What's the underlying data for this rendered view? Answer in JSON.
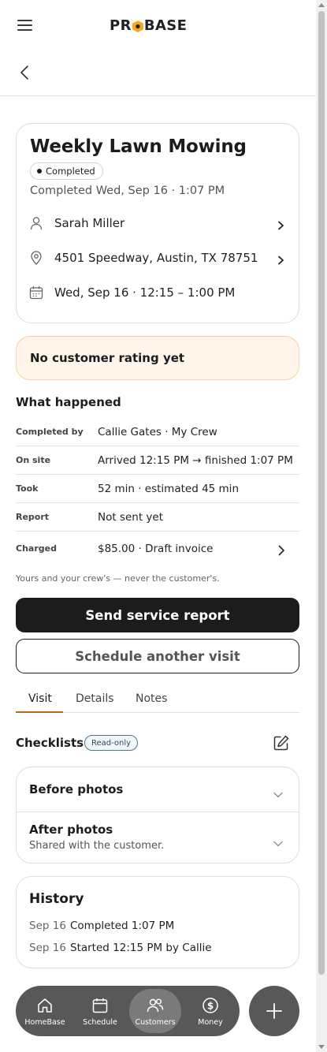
{
  "header": {
    "logo_left": "PR",
    "logo_right": "BASE",
    "accent_color": "#f5a623"
  },
  "job": {
    "title": "Weekly Lawn Mowing",
    "status": "Completed",
    "completed_line": "Completed Wed, Sep 16 · 1:07 PM",
    "customer": "Sarah Miller",
    "address": "4501 Speedway, Austin, TX 78751",
    "schedule": "Wed, Sep 16 · 12:15 – 1:00 PM"
  },
  "rating": {
    "text": "No customer rating yet",
    "bg_color": "#fff5eb"
  },
  "what_happened": {
    "heading": "What happened",
    "rows": [
      {
        "key": "Completed by",
        "value": "Callie Gates · My Crew"
      },
      {
        "key": "On site",
        "value": "Arrived 12:15 PM → finished 1:07 PM"
      },
      {
        "key": "Took",
        "value": "52 min · estimated 45 min"
      },
      {
        "key": "Report",
        "value": "Not sent yet"
      },
      {
        "key": "Charged",
        "value": "$85.00 · Draft invoice"
      }
    ],
    "footnote": "Yours and your crew's — never the customer's."
  },
  "actions": {
    "primary": "Send service report",
    "secondary": "Schedule another visit"
  },
  "tabs": [
    "Visit",
    "Details",
    "Notes"
  ],
  "checklists": {
    "heading": "Checklists",
    "badge": "Read-only",
    "items": [
      {
        "title": "Before photos",
        "subtitle": ""
      },
      {
        "title": "After photos",
        "subtitle": "Shared with the customer."
      }
    ]
  },
  "history": {
    "heading": "History",
    "entries": [
      {
        "date": "Sep 16",
        "event": "Completed 1:07 PM"
      },
      {
        "date": "Sep 16",
        "event": "Started 12:15 PM by Callie"
      }
    ]
  },
  "bottom_nav": {
    "items": [
      {
        "label": "HomeBase",
        "icon": "home-icon"
      },
      {
        "label": "Schedule",
        "icon": "calendar-icon"
      },
      {
        "label": "Customers",
        "icon": "users-icon",
        "active": true
      },
      {
        "label": "Money",
        "icon": "dollar-icon"
      }
    ],
    "fab_icon": "plus-icon"
  }
}
